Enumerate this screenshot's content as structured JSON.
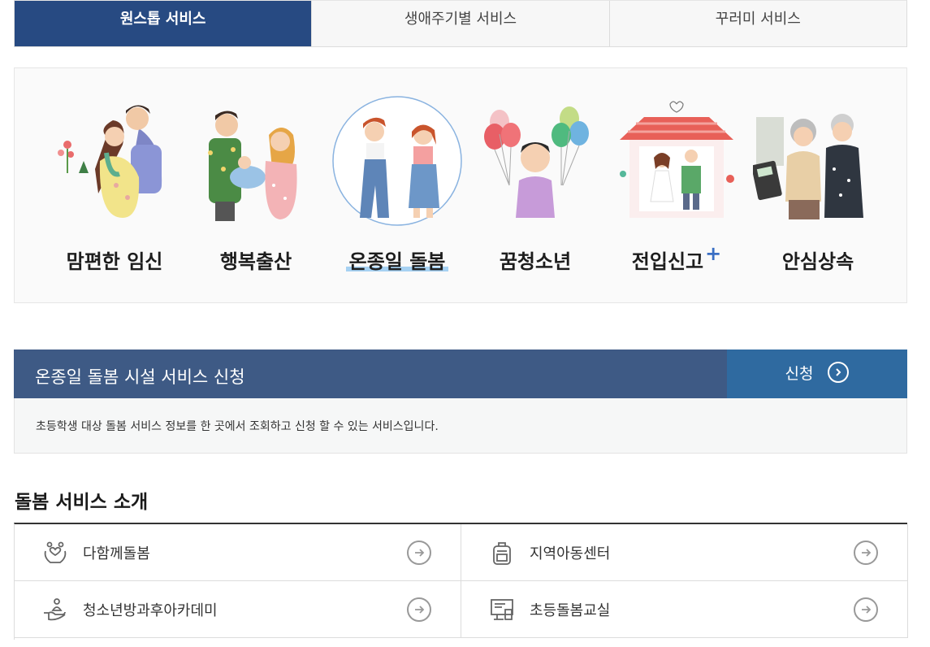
{
  "tabs": [
    {
      "label": "원스톱 서비스",
      "active": true
    },
    {
      "label": "생애주기별 서비스",
      "active": false
    },
    {
      "label": "꾸러미 서비스",
      "active": false
    }
  ],
  "categories": [
    {
      "label": "맘편한 임신"
    },
    {
      "label": "행복출산"
    },
    {
      "label": "온종일 돌봄",
      "active": true
    },
    {
      "label": "꿈청소년"
    },
    {
      "label": "전입신고",
      "plus": "+"
    },
    {
      "label": "안심상속"
    }
  ],
  "apply": {
    "title": "온종일 돌봄 시설 서비스 신청",
    "button": "신청",
    "description": "초등학생 대상 돌봄 서비스 정보를 한 곳에서 조회하고 신청 할 수 있는 서비스입니다."
  },
  "intro": {
    "title": "돌봄 서비스 소개",
    "services": [
      {
        "name": "다함께돌봄",
        "icon": "hands-heart-icon"
      },
      {
        "name": "지역아동센터",
        "icon": "backpack-icon"
      },
      {
        "name": "청소년방과후아카데미",
        "icon": "hand-person-icon"
      },
      {
        "name": "초등돌봄교실",
        "icon": "classroom-icon"
      }
    ]
  },
  "colors": {
    "tab_active": "#274a82",
    "apply_bar": "#3e5a85",
    "apply_button": "#2f6aa0",
    "highlight": "#a6d1f2"
  }
}
